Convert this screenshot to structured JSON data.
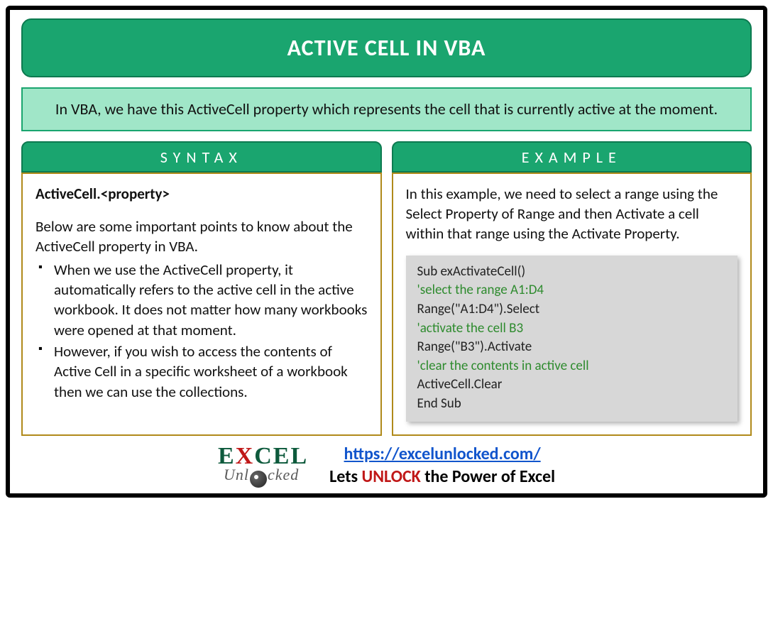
{
  "title": "ACTIVE CELL IN VBA",
  "intro": "In VBA, we have this ActiveCell property which represents the cell that is currently active at the moment.",
  "syntax": {
    "tab": "SYNTAX",
    "heading": "ActiveCell.<property>",
    "lead": "Below are some important points to know about the ActiveCell property in VBA.",
    "points": [
      "When we use the ActiveCell property, it automatically refers to the active cell in the active workbook. It does not matter how many workbooks were opened at that moment.",
      "However, if you wish to access the contents of Active Cell in a specific worksheet of a workbook then we can use the collections."
    ]
  },
  "example": {
    "tab": "EXAMPLE",
    "lead": "In this example, we need to select a range using the Select Property of Range and then Activate a cell within that range using the Activate Property.",
    "code": {
      "l1": "Sub exActivateCell()",
      "c1": "'select the range A1:D4",
      "l2": "Range(\"A1:D4\").Select",
      "c2": "'activate the cell B3",
      "l3": "Range(\"B3\").Activate",
      "c3": "'clear the contents in active cell",
      "l4": "ActiveCell.Clear",
      "l5": "End Sub"
    }
  },
  "footer": {
    "logo_top_1": "E",
    "logo_top_2": "X",
    "logo_top_3": "CEL",
    "logo_bottom_1": "Unl",
    "logo_bottom_2": "cked",
    "url": "https://excelunlocked.com/",
    "tag_prefix": "Lets ",
    "tag_mid": "UNLOCK",
    "tag_suffix": " the Power of Excel"
  }
}
